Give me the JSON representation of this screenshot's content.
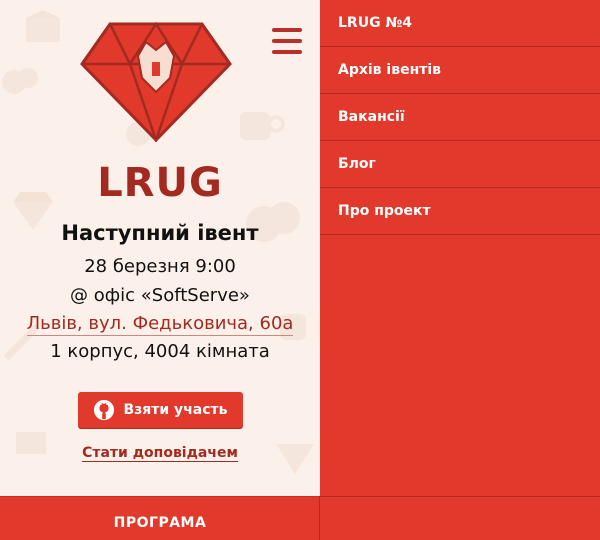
{
  "brand": {
    "name": "LRUG",
    "logo_icon": "diamond-lion-logo"
  },
  "event": {
    "title": "Наступний івент",
    "date": "28 березня 9:00",
    "venue": "@ офіс «SoftServe»",
    "address": "Львів, вул. Федьковича, 60а",
    "room": "1 корпус, 4004 кімната"
  },
  "actions": {
    "join_label": "Взяти участь",
    "join_icon": "github-icon",
    "speaker_label": "Стати доповідачем"
  },
  "footer": {
    "program_label": "ПРОГРАМА"
  },
  "menu": {
    "items": [
      {
        "label": "LRUG №4"
      },
      {
        "label": "Архів івентів"
      },
      {
        "label": "Вакансії"
      },
      {
        "label": "Блог"
      },
      {
        "label": "Про проект"
      }
    ]
  },
  "colors": {
    "accent": "#e1392b",
    "dark_red": "#a32a20",
    "background": "#fbf1ea"
  }
}
